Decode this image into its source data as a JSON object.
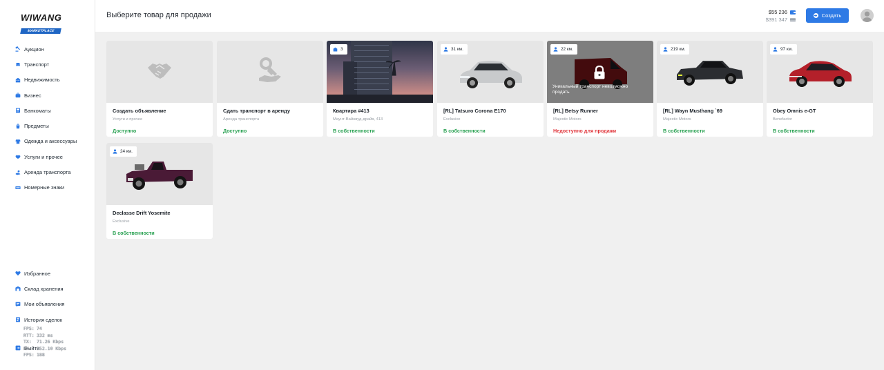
{
  "app": {
    "logo_main": "WIWANG",
    "logo_sub": "MARKETPLACE"
  },
  "sidebar": {
    "items": [
      {
        "label": "Аукцион",
        "icon": "auction-icon"
      },
      {
        "label": "Транспорт",
        "icon": "car-icon"
      },
      {
        "label": "Недвижимость",
        "icon": "building-icon"
      },
      {
        "label": "Бизнес",
        "icon": "briefcase-icon"
      },
      {
        "label": "Банкоматы",
        "icon": "atm-icon"
      },
      {
        "label": "Предметы",
        "icon": "items-icon"
      },
      {
        "label": "Одежда и аксессуары",
        "icon": "clothes-icon"
      },
      {
        "label": "Услуги и прочее",
        "icon": "handshake-icon"
      },
      {
        "label": "Аренда транспорта",
        "icon": "rent-icon"
      },
      {
        "label": "Номерные знаки",
        "icon": "plate-icon"
      }
    ],
    "bottom_items": [
      {
        "label": "Избранное",
        "icon": "heart-icon"
      },
      {
        "label": "Склад хранения",
        "icon": "warehouse-icon"
      },
      {
        "label": "Мои объявления",
        "icon": "ads-icon"
      },
      {
        "label": "История сделок",
        "icon": "history-icon"
      },
      {
        "label": "Выйти",
        "icon": "exit-icon"
      }
    ],
    "accent_color": "#2e7ae5"
  },
  "debug_overlay": {
    "rows": [
      {
        "k": "FPS:",
        "v": "74"
      },
      {
        "k": "RTT:",
        "v": "332 ms"
      },
      {
        "k": "TX:",
        "v": "71.26 Kbps"
      },
      {
        "k": "RX:",
        "v": "352.10 Kbps"
      },
      {
        "k": "FPS:",
        "v": "188"
      }
    ]
  },
  "header": {
    "title": "Выберите товар для продажи",
    "cash": "$55 236",
    "bank": "$391 347",
    "create_label": "Создать"
  },
  "cards": [
    {
      "title": "Создать объявление",
      "subtitle": "Услуги и прочее",
      "status": "Доступно",
      "status_kind": "ok",
      "media": "handshake"
    },
    {
      "title": "Сдать транспорт в аренду",
      "subtitle": "Аренда транспорта",
      "status": "Доступно",
      "status_kind": "ok",
      "media": "key-hand"
    },
    {
      "title": "Квартира #413",
      "subtitle": "Маунт-Вайнвуд-драйв, 413",
      "status": "В собственности",
      "status_kind": "ok",
      "media": "apartment",
      "badge": "3",
      "badge_icon": "building-icon"
    },
    {
      "title": "[RL] Tatsuro Corona E170",
      "subtitle": "Exclusive",
      "status": "В собственности",
      "status_kind": "ok",
      "media": "car-silver",
      "badge": "31 км.",
      "badge_icon": "person-icon"
    },
    {
      "title": "[RL] Betsy Runner",
      "subtitle": "Majestic Motors",
      "status": "Недоступно для продажи",
      "status_kind": "bad",
      "media": "van-red",
      "badge": "22 км.",
      "badge_icon": "person-icon",
      "locked_text": "Уникальный транспорт невозможно продать"
    },
    {
      "title": "[RL] Wayn Musthang `69",
      "subtitle": "Majestic Motors",
      "status": "В собственности",
      "status_kind": "ok",
      "media": "car-black",
      "badge": "219 км.",
      "badge_icon": "person-icon"
    },
    {
      "title": "Obey Omnis e-GT",
      "subtitle": "Benefactor",
      "status": "В собственности",
      "status_kind": "ok",
      "media": "car-red",
      "badge": "97 км.",
      "badge_icon": "person-icon"
    },
    {
      "title": "Declasse Drift Yosemite",
      "subtitle": "Exclusive",
      "status": "В собственности",
      "status_kind": "ok",
      "media": "truck-purple",
      "badge": "24 км.",
      "badge_icon": "person-icon"
    }
  ]
}
